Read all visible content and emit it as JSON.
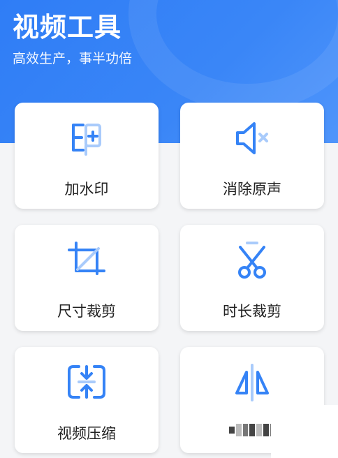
{
  "header": {
    "title": "视频工具",
    "subtitle": "高效生产，事半功倍"
  },
  "colors": {
    "accent": "#3583f6",
    "icon_light": "#a9cbfb",
    "card_bg": "#ffffff",
    "page_bg": "#f4f5f7"
  },
  "tools": [
    {
      "label": "加水印",
      "icon": "watermark-icon"
    },
    {
      "label": "消除原声",
      "icon": "mute-icon"
    },
    {
      "label": "尺寸裁剪",
      "icon": "crop-icon"
    },
    {
      "label": "时长裁剪",
      "icon": "scissors-icon"
    },
    {
      "label": "视频压缩",
      "icon": "compress-icon"
    },
    {
      "label": "",
      "icon": "mirror-icon"
    }
  ]
}
